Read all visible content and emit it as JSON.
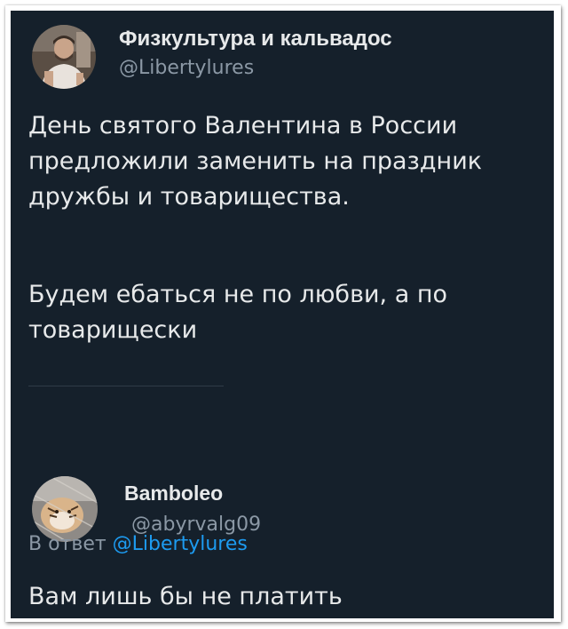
{
  "tweet": {
    "author_name": "Физкультура и кальвадос",
    "author_handle": "@Libertylures",
    "avatar_icon": "profile-photo-man-avatar",
    "paragraph_1": "День святого Валентина в России\nпредложили заменить на праздник\nдружбы и товарищества.",
    "paragraph_2": "Будем ебаться не по любви, а по\nтоварищески"
  },
  "reply": {
    "author_name": "Bamboleo",
    "author_handle": "@abyrvalg09",
    "avatar_icon": "profile-photo-tiger-avatar",
    "reply_prefix": "В ответ ",
    "reply_to": "@Libertylures",
    "text": "Вам лишь бы не платить"
  },
  "colors": {
    "background": "#15202b",
    "text": "#e7e9ea",
    "muted": "#8b98a5",
    "link": "#1d9bf0"
  }
}
